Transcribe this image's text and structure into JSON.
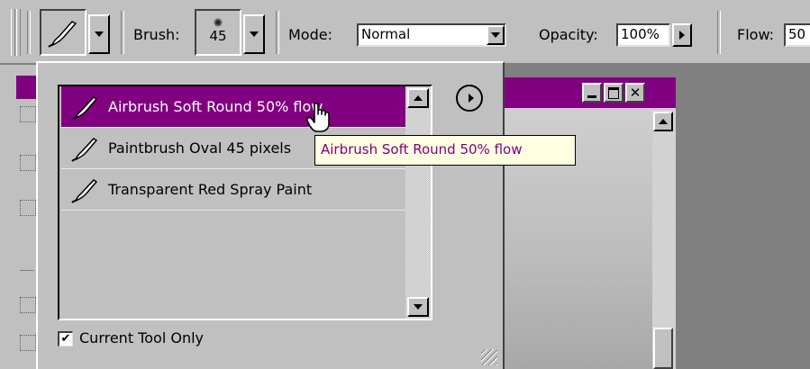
{
  "options_bar": {
    "brush_label": "Brush:",
    "brush_size": "45",
    "mode_label": "Mode:",
    "mode_value": "Normal",
    "opacity_label": "Opacity:",
    "opacity_value": "100%",
    "flow_label": "Flow:",
    "flow_value": "50"
  },
  "presets_panel": {
    "items": [
      {
        "label": "Airbrush Soft Round 50% flow",
        "selected": true
      },
      {
        "label": "Paintbrush Oval 45 pixels",
        "selected": false
      },
      {
        "label": "Transparent Red Spray Paint",
        "selected": false
      }
    ],
    "current_tool_only_label": "Current Tool Only",
    "current_tool_only_checked": true
  },
  "tooltip": {
    "text": "Airbrush Soft Round 50% flow"
  },
  "colors": {
    "selection": "#800080",
    "tooltip_bg": "#ffffe1",
    "tooltip_text": "#800080"
  },
  "icons": [
    "brush-tool-icon",
    "brush-preset-icon",
    "panel-menu-arrow-icon",
    "hand-pointer-icon",
    "checkbox-check-icon"
  ]
}
